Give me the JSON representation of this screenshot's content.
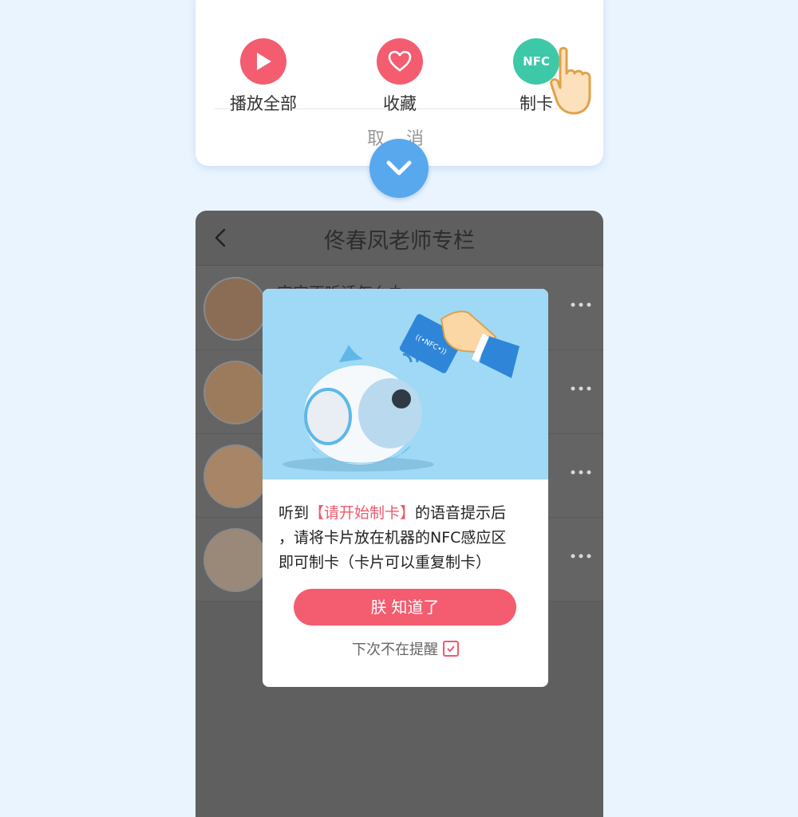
{
  "sheet": {
    "actions": [
      {
        "label": "播放全部",
        "icon": "play-icon",
        "color": "#f45c70"
      },
      {
        "label": "收藏",
        "icon": "heart-icon",
        "color": "#f45c70"
      },
      {
        "label": "制卡",
        "icon_text": "NFC",
        "color": "#3dc8a8"
      }
    ],
    "cancel": "取 消"
  },
  "screen": {
    "title": "佟春凤老师专栏",
    "rows": [
      {
        "title": "宝宝不听话怎么办"
      },
      {
        "title": ""
      },
      {
        "title": ""
      },
      {
        "title": ""
      }
    ]
  },
  "modal": {
    "msg_prefix": "听到",
    "msg_highlight": "【请开始制卡】",
    "msg_mid": "的语音提示后",
    "msg_line2": "，请将卡片放在机器的NFC感应区",
    "msg_line3": "即可制卡（卡片可以重复制卡）",
    "ok_icon": "朕",
    "ok_label": "知道了",
    "no_remind": "下次不在提醒",
    "nfc_card_text": "((•NFC•))"
  },
  "colors": {
    "accent": "#f45c70",
    "nfc": "#3dc8a8",
    "collapse": "#58a8ee"
  }
}
